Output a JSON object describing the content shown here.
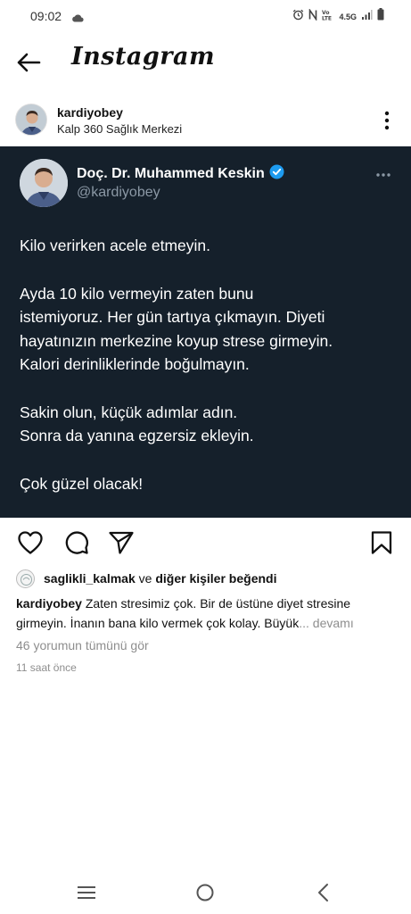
{
  "status_bar": {
    "time": "09:02",
    "network": "4.5G",
    "icons": [
      "cloud-icon",
      "alarm-icon",
      "nfc-icon",
      "volte-icon",
      "signal-icon",
      "battery-icon"
    ]
  },
  "app": {
    "title": "Instagram",
    "back_icon": "back-arrow-icon"
  },
  "post": {
    "username": "kardiyobey",
    "location": "Kalp 360 Sağlık Merkezi",
    "menu_icon": "more-vertical-icon"
  },
  "tweet": {
    "name": "Doç. Dr. Muhammed Keskin",
    "handle": "@kardiyobey",
    "verified": true,
    "bg_color": "#15202b",
    "text_color": "#ffffff",
    "handle_color": "#8b98a5",
    "verified_color": "#1d9bf0",
    "lines": [
      "Kilo verirken acele etmeyin.",
      "",
      "Ayda 10 kilo vermeyin zaten bunu",
      "istemiyoruz. Her gün tartıya çıkmayın. Diyeti",
      "hayatınızın merkezine koyup strese girmeyin.",
      "Kalori derinliklerinde boğulmayın.",
      "",
      "Sakin olun, küçük adımlar adın.",
      "Sonra da yanına egzersiz ekleyin.",
      "",
      "Çok güzel olacak!"
    ]
  },
  "actions": {
    "like": "heart-icon",
    "comment": "comment-icon",
    "share": "send-icon",
    "save": "bookmark-icon"
  },
  "likes": {
    "first_user": "saglikli_kalmak",
    "connector": " ve ",
    "others": "diğer kişiler beğendi"
  },
  "caption": {
    "username": "kardiyobey",
    "text": " Zaten stresimiz çok. Bir de üstüne diyet stresine girmeyin. İnanın bana kilo vermek çok kolay. Büyük",
    "more": "... devamı"
  },
  "comments_link": "46 yorumun tümünü gör",
  "time_ago": "11 saat önce",
  "nav": {
    "recents": "recents-icon",
    "home": "home-icon",
    "back": "back-icon"
  }
}
